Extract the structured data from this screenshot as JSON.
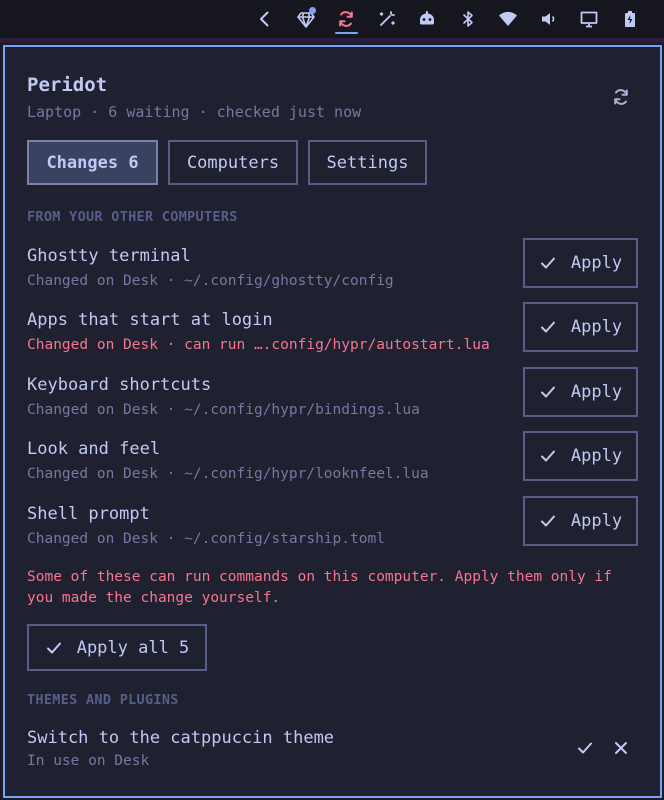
{
  "topbar": {
    "icons": [
      "chevron-left-icon",
      "gem-icon",
      "sync-icon",
      "wand-icon",
      "robot-icon",
      "bluetooth-icon",
      "wifi-icon",
      "volume-icon",
      "monitor-icon",
      "battery-icon"
    ],
    "active_icon": "sync-icon",
    "accent": "#7aa2f7"
  },
  "panel": {
    "title": "Peridot",
    "subtitle": "Laptop · 6 waiting · checked just now"
  },
  "tabs": [
    {
      "label": "Changes 6",
      "active": true
    },
    {
      "label": "Computers",
      "active": false
    },
    {
      "label": "Settings",
      "active": false
    }
  ],
  "sections": {
    "other_computers": "FROM YOUR OTHER COMPUTERS",
    "themes": "THEMES AND PLUGINS"
  },
  "changes": [
    {
      "title": "Ghostty terminal",
      "detail": "Changed on Desk · ~/.config/ghostty/config",
      "danger": false,
      "button": "Apply"
    },
    {
      "title": "Apps that start at login",
      "detail": "Changed on Desk · can run ….config/hypr/autostart.lua",
      "danger": true,
      "button": "Apply"
    },
    {
      "title": "Keyboard shortcuts",
      "detail": "Changed on Desk · ~/.config/hypr/bindings.lua",
      "danger": false,
      "button": "Apply"
    },
    {
      "title": "Look and feel",
      "detail": "Changed on Desk · ~/.config/hypr/looknfeel.lua",
      "danger": false,
      "button": "Apply"
    },
    {
      "title": "Shell prompt",
      "detail": "Changed on Desk · ~/.config/starship.toml",
      "danger": false,
      "button": "Apply"
    }
  ],
  "warning": "Some of these can run commands on this computer. Apply them only if you made the change yourself.",
  "apply_all_label": "Apply all 5",
  "theme": {
    "title": "Switch to the catppuccin theme",
    "detail": "In use on Desk"
  },
  "colors": {
    "danger": "#f7768e",
    "muted": "#737aa2",
    "border": "#565f89"
  }
}
